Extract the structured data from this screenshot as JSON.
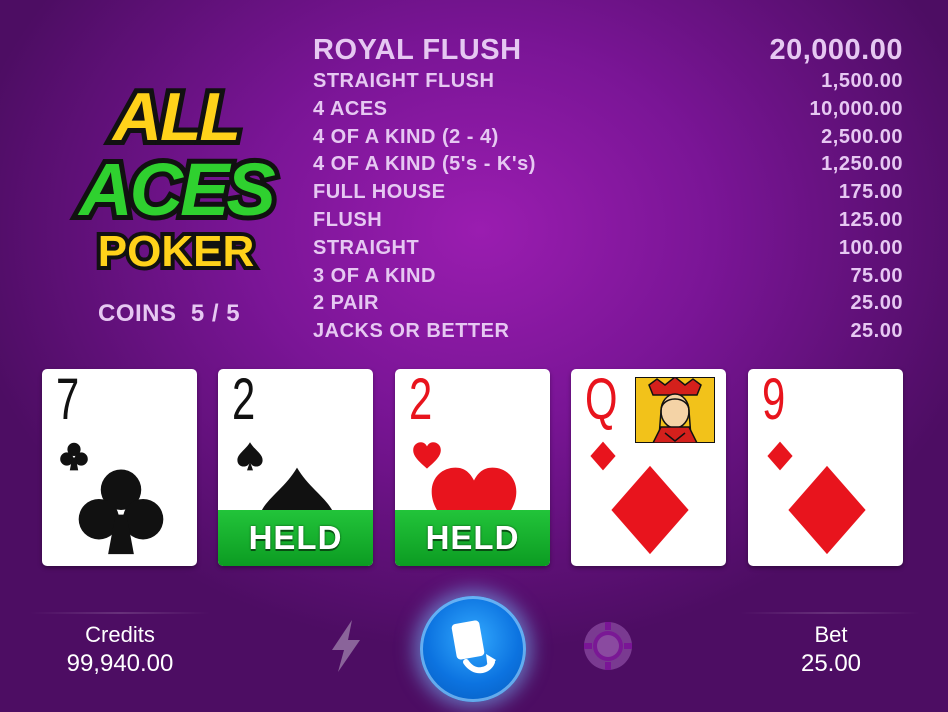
{
  "game": {
    "logo": {
      "line1": "ALL",
      "line2": "ACES",
      "line3": "POKER"
    },
    "coins_label": "COINS",
    "coins_value": "5 / 5"
  },
  "paytable": [
    {
      "hand": "ROYAL FLUSH",
      "payout": "20,000.00"
    },
    {
      "hand": "STRAIGHT FLUSH",
      "payout": "1,500.00"
    },
    {
      "hand": "4 ACES",
      "payout": "10,000.00"
    },
    {
      "hand": "4 OF A KIND (2 - 4)",
      "payout": "2,500.00"
    },
    {
      "hand": "4 OF A KIND (5's - K's)",
      "payout": "1,250.00"
    },
    {
      "hand": "FULL HOUSE",
      "payout": "175.00"
    },
    {
      "hand": "FLUSH",
      "payout": "125.00"
    },
    {
      "hand": "STRAIGHT",
      "payout": "100.00"
    },
    {
      "hand": "3 OF A KIND",
      "payout": "75.00"
    },
    {
      "hand": "2 PAIR",
      "payout": "25.00"
    },
    {
      "hand": "JACKS OR BETTER",
      "payout": "25.00"
    }
  ],
  "cards": [
    {
      "rank": "7",
      "suit": "clubs",
      "held": false
    },
    {
      "rank": "2",
      "suit": "spades",
      "held": true
    },
    {
      "rank": "2",
      "suit": "hearts",
      "held": true
    },
    {
      "rank": "Q",
      "suit": "diamonds",
      "held": false
    },
    {
      "rank": "9",
      "suit": "diamonds",
      "held": false
    }
  ],
  "held_label": "HELD",
  "bottom": {
    "credits_label": "Credits",
    "credits_value": "99,940.00",
    "bet_label": "Bet",
    "bet_value": "25.00",
    "icons": [
      "lightning-icon",
      "deal-cards-icon",
      "chip-icon"
    ]
  },
  "colors": {
    "background": "#7a1596",
    "paytable_text": "#e6c8f2",
    "held_green": "#22c43a",
    "deal_button": "#0c73e0",
    "red_suit": "#e8141d",
    "logo_yellow": "#ffd21a",
    "logo_green": "#2fd12f"
  }
}
